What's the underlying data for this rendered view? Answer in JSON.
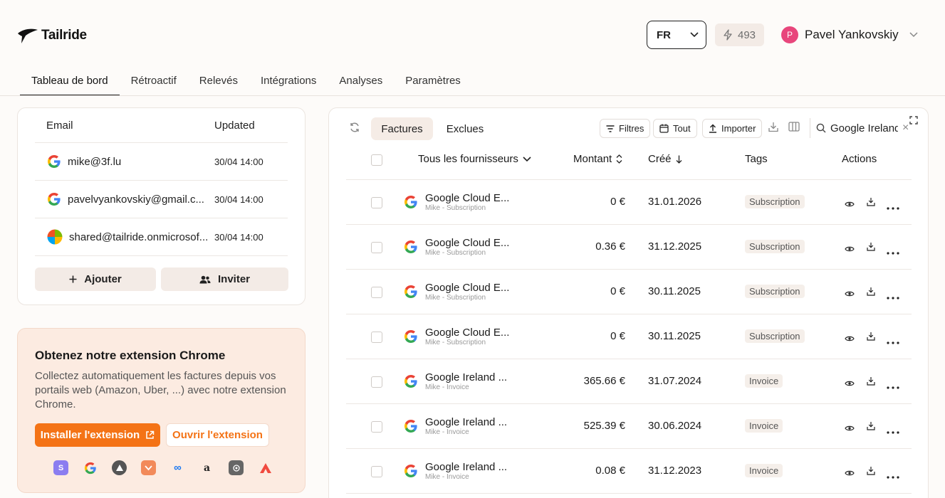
{
  "brand": {
    "name": "Tailride"
  },
  "header": {
    "language": "FR",
    "credits": "493",
    "user": {
      "initial": "P",
      "name": "Pavel Yankovskiy"
    }
  },
  "nav": {
    "items": [
      {
        "label": "Tableau de bord"
      },
      {
        "label": "Rétroactif"
      },
      {
        "label": "Relevés"
      },
      {
        "label": "Intégrations"
      },
      {
        "label": "Analyses"
      },
      {
        "label": "Paramètres"
      }
    ]
  },
  "emails": {
    "col_email": "Email",
    "col_updated": "Updated",
    "rows": [
      {
        "email": "mike@3f.lu",
        "updated": "30/04 14:00",
        "icon": "google-icon"
      },
      {
        "email": "pavelvyankovskiy@gmail.c...",
        "updated": "30/04 14:00",
        "icon": "google-icon"
      },
      {
        "email": "shared@tailride.onmicrosof...",
        "updated": "30/04 14:00",
        "icon": "microsoft-icon"
      }
    ],
    "add_label": "Ajouter",
    "invite_label": "Inviter"
  },
  "extension": {
    "title": "Obtenez notre extension Chrome",
    "description": "Collectez automatiquement les factures depuis vos portails web (Amazon, Uber, ...) avec notre extension Chrome.",
    "install_label": "Installer l'extension",
    "open_label": "Ouvrir l'extension",
    "logos": [
      "stripe-icon",
      "google-icon",
      "vercel-icon",
      "shopify-icon",
      "meta-icon",
      "amazon-icon",
      "openai-icon",
      "anthropic-icon"
    ]
  },
  "invoices": {
    "tabs": [
      "Factures",
      "Exclues"
    ],
    "toolbar": {
      "filters": "Filtres",
      "all": "Tout",
      "import": "Importer",
      "search_value": "Google Ireland"
    },
    "columns": {
      "vendor": "Tous les fournisseurs",
      "amount": "Montant",
      "created": "Créé",
      "tags": "Tags",
      "actions": "Actions"
    },
    "rows": [
      {
        "vendor": "Google Cloud E...",
        "sub": "Mike - Subscription",
        "amount": "0 €",
        "date": "31.01.2026",
        "tag": "Subscription"
      },
      {
        "vendor": "Google Cloud E...",
        "sub": "Mike - Subscription",
        "amount": "0.36 €",
        "date": "31.12.2025",
        "tag": "Subscription"
      },
      {
        "vendor": "Google Cloud E...",
        "sub": "Mike - Subscription",
        "amount": "0 €",
        "date": "30.11.2025",
        "tag": "Subscription"
      },
      {
        "vendor": "Google Cloud E...",
        "sub": "Mike - Subscription",
        "amount": "0 €",
        "date": "30.11.2025",
        "tag": "Subscription"
      },
      {
        "vendor": "Google Ireland ...",
        "sub": "Mike - Invoice",
        "amount": "365.66 €",
        "date": "31.07.2024",
        "tag": "Invoice"
      },
      {
        "vendor": "Google Ireland ...",
        "sub": "Mike - Invoice",
        "amount": "525.39 €",
        "date": "30.06.2024",
        "tag": "Invoice"
      },
      {
        "vendor": "Google Ireland ...",
        "sub": "Mike - Invoice",
        "amount": "0.08 €",
        "date": "31.12.2023",
        "tag": "Invoice"
      }
    ]
  },
  "colors": {
    "accent": "#f47316",
    "avatar": "#e8467c",
    "segment_active": "#f5ece6",
    "extension_bg": "#fcebe1"
  }
}
